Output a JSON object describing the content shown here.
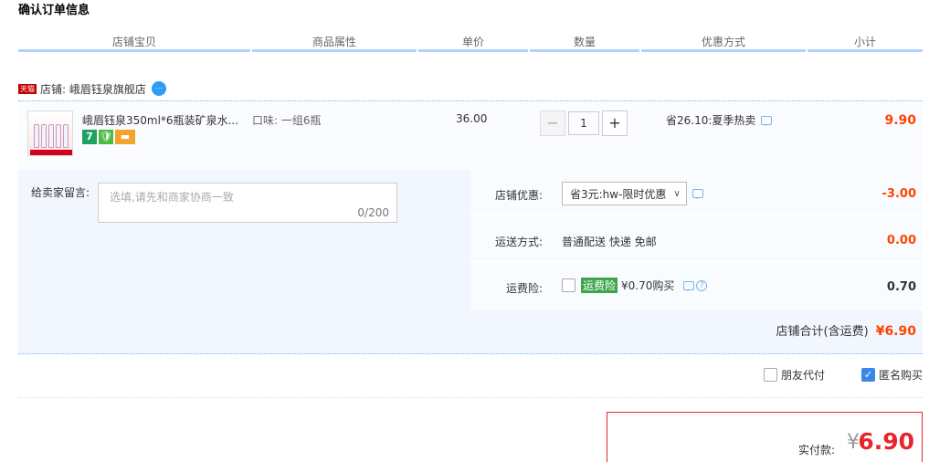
{
  "page": {
    "title": "确认订单信息"
  },
  "table_headers": [
    {
      "label": "店铺宝贝"
    },
    {
      "label": "商品属性"
    },
    {
      "label": "单价"
    },
    {
      "label": "数量"
    },
    {
      "label": "优惠方式"
    },
    {
      "label": "小计"
    }
  ],
  "shop": {
    "badge": "天猫",
    "label": "店铺: 峨眉钰泉旗舰店",
    "wangwang_icon": "chat-bubble-icon"
  },
  "item": {
    "title": "峨眉钰泉350ml*6瓶装矿泉水...",
    "attr": "口味: 一组6瓶",
    "price": "36.00",
    "quantity": "1",
    "minus": "−",
    "plus": "+",
    "promo": "省26.10:夏季热卖",
    "subtotal": "9.90",
    "badges": {
      "seven": "7",
      "guarantee": "🛡",
      "card": "▬"
    }
  },
  "message": {
    "label": "给卖家留言:",
    "placeholder": "选填,请先和商家协商一致",
    "count": "0/200"
  },
  "shop_discount": {
    "label": "店铺优惠:",
    "value": "省3元:hw-限时优惠",
    "amount": "-3.00"
  },
  "shipping": {
    "label": "运送方式:",
    "value": "普通配送 快递 免邮",
    "amount": "0.00"
  },
  "insurance": {
    "label": "运费险:",
    "tag": "运费险",
    "value": "¥0.70购买",
    "amount": "0.70",
    "checked": false
  },
  "shop_total": {
    "label": "店铺合计(含运费)",
    "amount": "¥6.90"
  },
  "options": {
    "friend_pay": {
      "label": "朋友代付",
      "checked": false
    },
    "anonymous": {
      "label": "匿名购买",
      "checked": true
    }
  },
  "payment": {
    "label": "实付款:",
    "currency": "¥",
    "amount": "6.90"
  },
  "colors": {
    "accent_red": "#ff4400",
    "pay_border": "#e5262d",
    "header_underline": "#b2d1ff",
    "row_bg": "#f2f7ff"
  }
}
